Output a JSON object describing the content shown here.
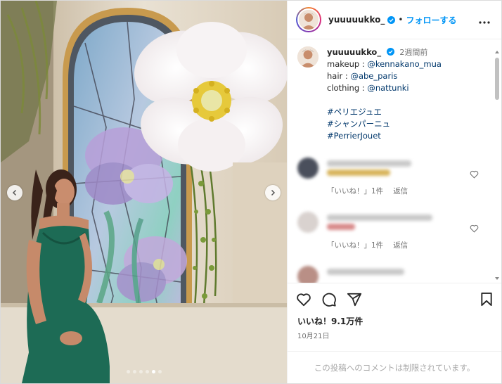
{
  "post": {
    "username": "yuuuuukko_",
    "follow_label": "フォローする",
    "separator": "•",
    "time_ago": "2週間前",
    "caption_lines": [
      {
        "prefix": "makeup : ",
        "link": "@kennakano_mua"
      },
      {
        "prefix": "hair : ",
        "link": "@abe_paris"
      },
      {
        "prefix": "clothing : ",
        "link": "@nattunki"
      }
    ],
    "hashtags": [
      "#ペリエジュエ",
      "#シャンパーニュ",
      "#PerrierJouet"
    ],
    "likes": "いいね！9.1万件",
    "date": "10月21日",
    "comments_disabled": "この投稿へのコメントは制限されています。"
  },
  "comments": [
    {
      "likes_label": "「いいね！」1件",
      "reply_label": "返信"
    },
    {
      "likes_label": "「いいね！」1件",
      "reply_label": "返信"
    },
    {
      "likes_label": "",
      "reply_label": ""
    }
  ],
  "carousel": {
    "count": 6,
    "active_index": 4
  },
  "colors": {
    "accent": "#0095f6",
    "link": "#00376b",
    "muted": "#737373"
  },
  "icons": [
    "verified-icon",
    "more-icon",
    "heart-icon",
    "comment-icon",
    "share-icon",
    "bookmark-icon",
    "chevron-left-icon",
    "chevron-right-icon"
  ]
}
